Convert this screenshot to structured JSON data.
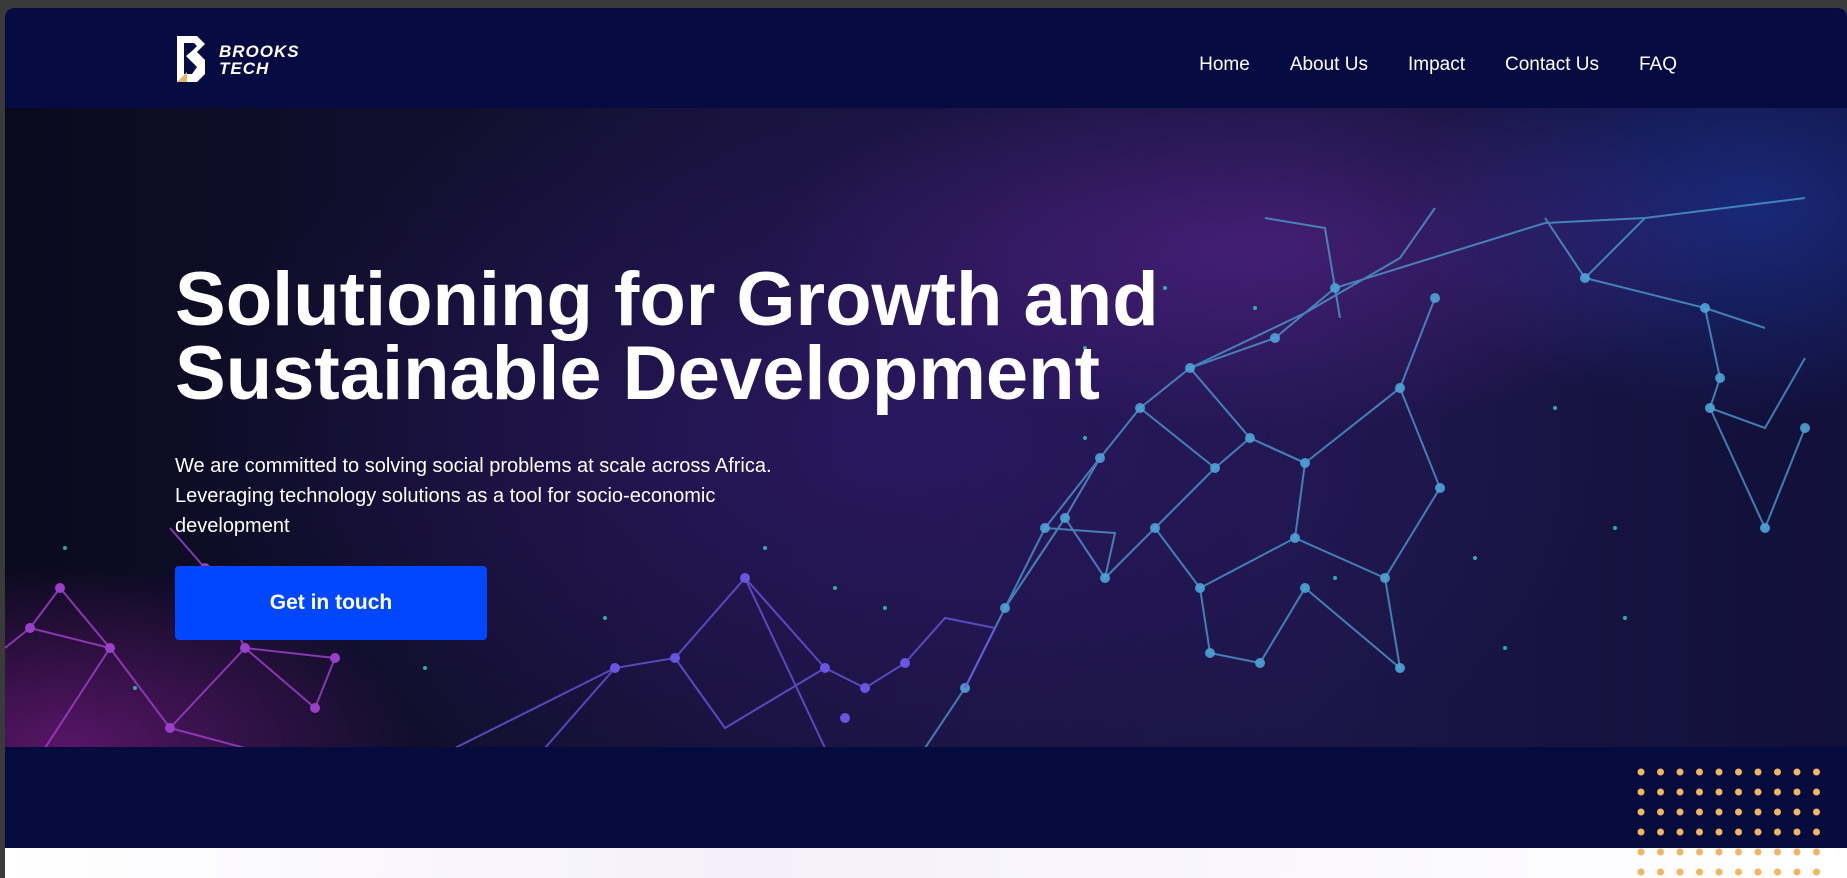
{
  "brand": {
    "name_line1": "BROOKS",
    "name_line2": "TECH",
    "logo_icon": "brooks-b-mark-icon"
  },
  "nav": {
    "items": [
      {
        "label": "Home"
      },
      {
        "label": "About Us"
      },
      {
        "label": "Impact"
      },
      {
        "label": "Contact Us"
      },
      {
        "label": "FAQ"
      }
    ]
  },
  "hero": {
    "title": "Solutioning for Growth and Sustainable Development",
    "description": "We are committed to solving social problems at scale across Africa. Leveraging technology solutions as a tool for socio-economic development",
    "cta_label": "Get in touch"
  },
  "colors": {
    "header_bg": "#060b42",
    "cta_bg": "#0047ff",
    "band_bg": "#060b3d",
    "dot_accent": "#f2b561",
    "network_blue": "#4fa3d6",
    "network_purple": "#8a3fd1",
    "logo_accent": "#e8b46a"
  }
}
